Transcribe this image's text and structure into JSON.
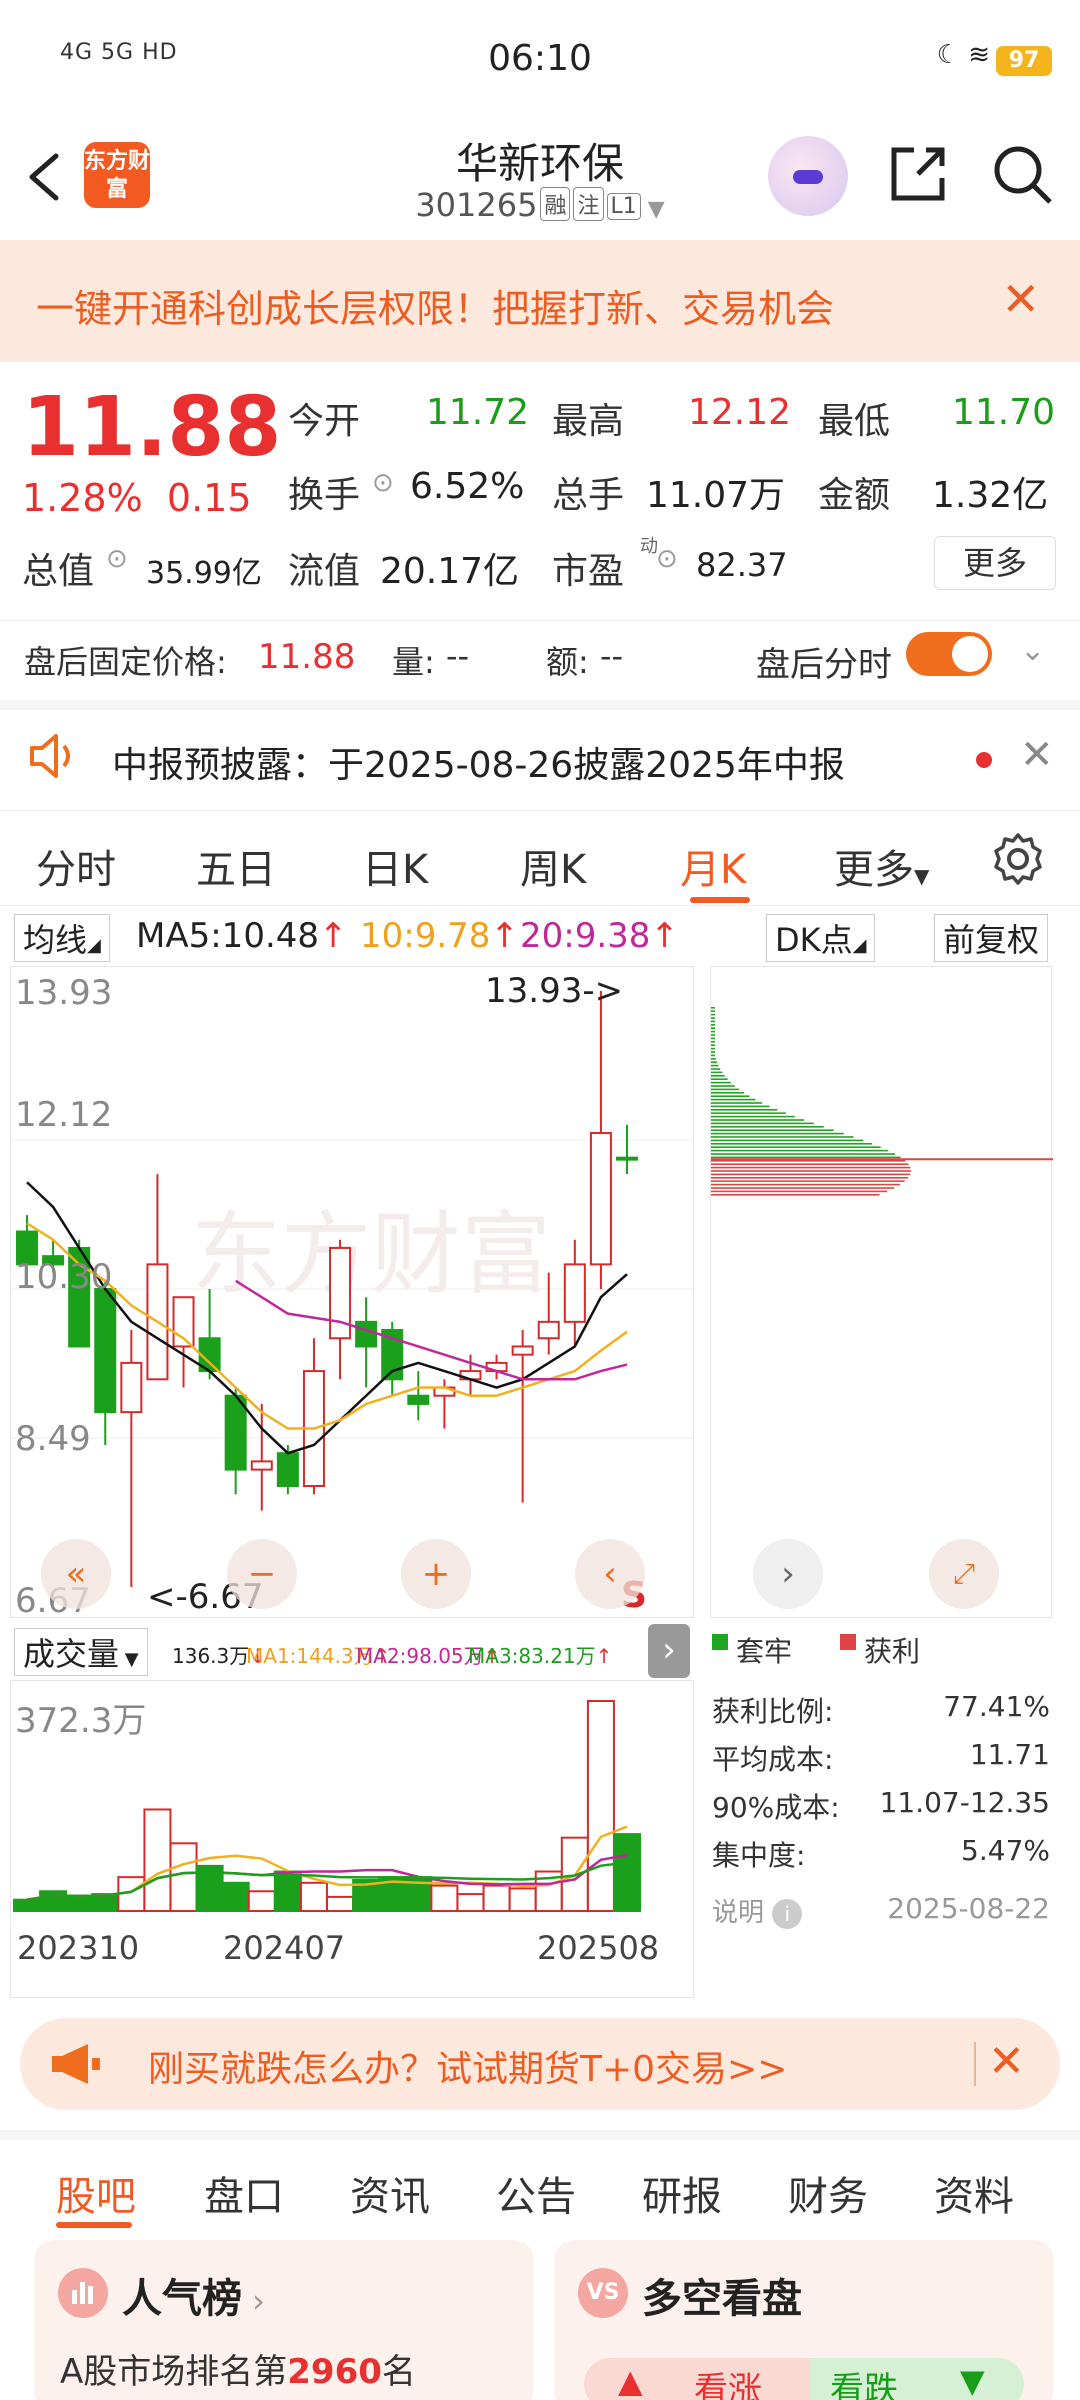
{
  "status_bar": {
    "time": "06:10",
    "network": "4G 5G HD",
    "battery": "97"
  },
  "header": {
    "logo": "东方财富",
    "name": "华新环保",
    "code": "301265",
    "tags": [
      "融",
      "注",
      "L1"
    ]
  },
  "banner": {
    "text": "一键开通科创成长层权限！把握打新、交易机会"
  },
  "quote": {
    "price": "11.88",
    "pct": "1.28%",
    "chg": "0.15",
    "open_label": "今开",
    "open": "11.72",
    "high_label": "最高",
    "high": "12.12",
    "low_label": "最低",
    "low": "11.70",
    "turnover_label": "换手",
    "turnover": "6.52%",
    "vol_label": "总手",
    "vol": "11.07万",
    "amount_label": "金额",
    "amount": "1.32亿",
    "mcap_label": "总值",
    "mcap": "35.99亿",
    "float_label": "流值",
    "float": "20.17亿",
    "pe_label": "市盈",
    "pe_sup": "动",
    "pe": "82.37",
    "more": "更多"
  },
  "after_hours": {
    "label": "盘后固定价格:",
    "price": "11.88",
    "vol_label": "量:",
    "vol": "--",
    "amt_label": "额:",
    "amt": "--",
    "timeshare": "盘后分时"
  },
  "notice": {
    "text": "中报预披露：于2025-08-26披露2025年中报"
  },
  "chart_tabs": [
    "分时",
    "五日",
    "日K",
    "周K",
    "月K",
    "更多"
  ],
  "active_chart_tab": "月K",
  "ma": {
    "btn": "均线",
    "ma5": "MA5:10.48",
    "ma10": "10:9.78",
    "ma20": "20:9.38",
    "dk": "DK点",
    "fq": "前复权"
  },
  "chart": {
    "y_labels": [
      "13.93",
      "12.12",
      "10.30",
      "8.49",
      "6.67"
    ],
    "max_mark": "13.93->",
    "min_mark": "<-6.67",
    "s_mark": "S",
    "watermark": "东方财富"
  },
  "volume": {
    "btn": "成交量",
    "v": "136.3万",
    "ma1": "MA1:144.3万",
    "ma2": "MA2:98.05万",
    "ma3": "MA3:83.21万",
    "max_label": "372.3万",
    "x_labels": [
      "202310",
      "202407",
      "202508"
    ]
  },
  "distribution": {
    "legend_trapped": "套牢",
    "legend_profit": "获利",
    "stats": [
      {
        "label": "获利比例:",
        "value": "77.41%"
      },
      {
        "label": "平均成本:",
        "value": "11.71"
      },
      {
        "label": "90%成本:",
        "value": "11.07-12.35"
      },
      {
        "label": "集中度:",
        "value": "5.47%"
      }
    ],
    "note": "说明",
    "date": "2025-08-22"
  },
  "promo": {
    "text": "刚买就跌怎么办？试试期货T+0交易>>"
  },
  "bottom_tabs": [
    "股吧",
    "盘口",
    "资讯",
    "公告",
    "研报",
    "财务",
    "资料"
  ],
  "cards": {
    "left_title": "人气榜",
    "left_sub_prefix": "A股市场排名第",
    "left_rank": "2960",
    "left_sub_suffix": "名",
    "right_title": "多空看盘",
    "right_up": "看涨",
    "right_down": "看跌"
  },
  "chart_data": {
    "type": "candlestick",
    "x": [
      "202309",
      "202310",
      "202311",
      "202312",
      "202401",
      "202402",
      "202403",
      "202404",
      "202405",
      "202406",
      "202407",
      "202408",
      "202409",
      "202410",
      "202411",
      "202412",
      "202501",
      "202502",
      "202503",
      "202504",
      "202505",
      "202506",
      "202507",
      "202508"
    ],
    "ohlc": [
      [
        11.0,
        11.2,
        10.6,
        10.6
      ],
      [
        10.7,
        10.9,
        10.5,
        10.6
      ],
      [
        10.8,
        10.9,
        9.6,
        9.6
      ],
      [
        10.3,
        10.4,
        8.4,
        8.8
      ],
      [
        8.8,
        9.8,
        6.67,
        9.4
      ],
      [
        9.2,
        11.7,
        9.3,
        10.6
      ],
      [
        9.6,
        10.1,
        9.1,
        10.2
      ],
      [
        9.7,
        10.3,
        9.2,
        9.3
      ],
      [
        9.0,
        9.1,
        7.8,
        8.1
      ],
      [
        8.1,
        8.9,
        7.6,
        8.2
      ],
      [
        8.3,
        8.4,
        7.8,
        7.9
      ],
      [
        7.9,
        9.7,
        7.8,
        9.3
      ],
      [
        9.7,
        10.9,
        9.2,
        10.8
      ],
      [
        9.9,
        10.2,
        9.1,
        9.6
      ],
      [
        9.8,
        9.9,
        9.0,
        9.2
      ],
      [
        9.0,
        9.3,
        8.7,
        8.9
      ],
      [
        9.0,
        9.2,
        8.6,
        9.1
      ],
      [
        9.2,
        9.5,
        9.0,
        9.3
      ],
      [
        9.3,
        9.5,
        9.2,
        9.4
      ],
      [
        9.5,
        9.8,
        7.7,
        9.6
      ],
      [
        9.7,
        10.5,
        9.5,
        9.9
      ],
      [
        9.9,
        10.9,
        9.6,
        10.6
      ],
      [
        10.6,
        13.93,
        10.3,
        12.2
      ],
      [
        11.9,
        12.3,
        11.7,
        11.88
      ]
    ],
    "series": [
      {
        "name": "MA5",
        "values": [
          11.6,
          11.3,
          10.8,
          10.3,
          9.9,
          9.7,
          9.5,
          9.3,
          9.0,
          8.6,
          8.3,
          8.4,
          8.7,
          9.0,
          9.3,
          9.4,
          9.3,
          9.2,
          9.1,
          9.2,
          9.4,
          9.6,
          10.2,
          10.48
        ]
      },
      {
        "name": "MA10",
        "values": [
          11.1,
          10.9,
          10.6,
          10.4,
          10.1,
          9.9,
          9.7,
          9.4,
          9.1,
          8.8,
          8.6,
          8.6,
          8.7,
          8.9,
          9.0,
          9.1,
          9.1,
          9.0,
          9.0,
          9.1,
          9.2,
          9.3,
          9.55,
          9.78
        ]
      },
      {
        "name": "MA20",
        "values": [
          null,
          null,
          null,
          null,
          null,
          null,
          null,
          null,
          10.4,
          10.2,
          10.0,
          9.95,
          9.9,
          9.8,
          9.7,
          9.6,
          9.5,
          9.4,
          9.3,
          9.2,
          9.2,
          9.2,
          9.3,
          9.38
        ]
      }
    ],
    "volume_wan": [
      20,
      35,
      25,
      30,
      60,
      180,
      120,
      80,
      50,
      35,
      70,
      50,
      25,
      55,
      60,
      60,
      45,
      30,
      45,
      40,
      70,
      130,
      372.3,
      136.3
    ],
    "ylim": [
      6.67,
      13.93
    ]
  }
}
